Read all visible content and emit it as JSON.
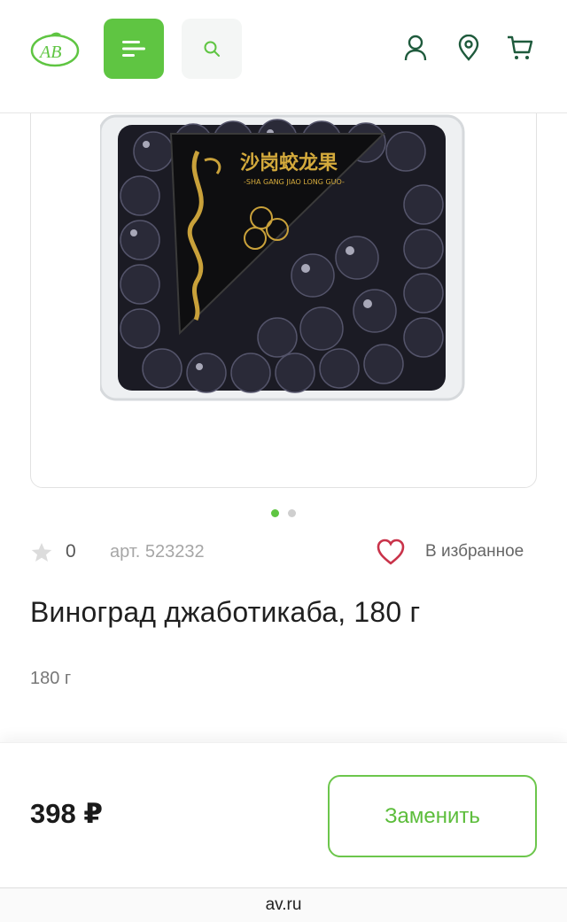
{
  "header": {
    "logo_alt": "АВ",
    "menu_icon": "menu-icon",
    "search_icon": "search-icon",
    "icons": [
      "user-icon",
      "location-pin-icon",
      "cart-icon"
    ],
    "accent_color": "#5fc542",
    "icon_color": "#1e5a3c"
  },
  "product_image": {
    "label_cn": "沙岗蛟龙果",
    "label_latin": "-SHA GANG JIAO LONG GUO-"
  },
  "carousel": {
    "count": 2,
    "active": 0
  },
  "meta": {
    "rating": "0",
    "article": "арт. 523232",
    "favorite_label": "В избранное"
  },
  "product": {
    "title": "Виноград джаботикаба, 180 г",
    "weight": "180 г"
  },
  "purchase": {
    "price": "398 ₽",
    "replace_label": "Заменить"
  },
  "browser": {
    "url": "av.ru"
  }
}
